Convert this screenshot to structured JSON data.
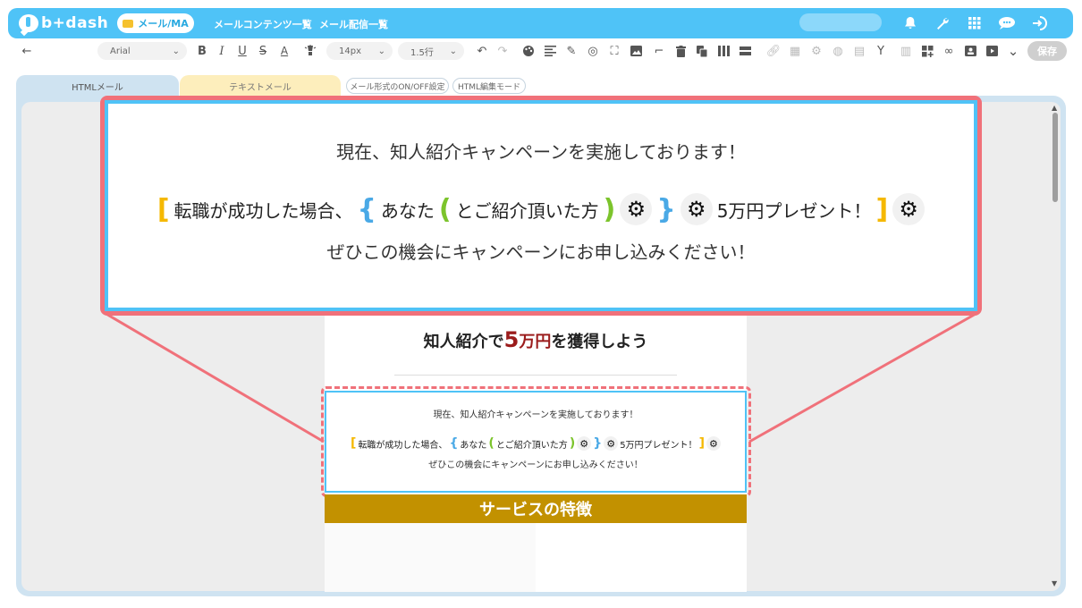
{
  "header": {
    "logo_text": "b+dash",
    "pill_label": "メール/MA",
    "nav": [
      "メールコンテンツ一覧",
      "メール配信一覧"
    ],
    "icons": [
      "bell-icon",
      "wrench-icon",
      "grid-icon",
      "chat-icon",
      "logout-icon"
    ]
  },
  "toolbar": {
    "back_glyph": "←",
    "font_family": "Arial",
    "font_size": "14px",
    "line_height": "1.5行",
    "save_label": "保存"
  },
  "tabs": {
    "html_label": "HTMLメール",
    "text_label": "テキストメール",
    "toggle_format_label": "メール形式のON/OFF設定",
    "html_edit_label": "HTML編集モード"
  },
  "email": {
    "headline_pre": "知人紹介で",
    "headline_big": "5",
    "headline_unit": "万円",
    "headline_post": "を獲得しよう",
    "line1": "現在、知人紹介キャンペーンを実施しております！",
    "merge_text_1": "転職が成功した場合、",
    "merge_text_2": "あなた",
    "merge_text_3": "とご紹介頂いた方",
    "merge_text_4": "5万円プレゼント！",
    "line3": "ぜひこの機会にキャンペーンにお申し込みください！",
    "service_heading": "サービスの特徴",
    "brackets": {
      "yellow_open": "[",
      "yellow_close": "]",
      "blue_open": "{",
      "blue_close": "}",
      "green_open": "(",
      "green_close": ")"
    },
    "gear_glyph": "⚙"
  },
  "colors": {
    "header_blue": "#4fc3f7",
    "callout_red": "#f0717a",
    "bracket_yellow": "#f5b800",
    "bracket_blue": "#4aa9e6",
    "bracket_green": "#7cc42c",
    "accent_dark_red": "#9b1c1c",
    "service_gold": "#c29100"
  }
}
